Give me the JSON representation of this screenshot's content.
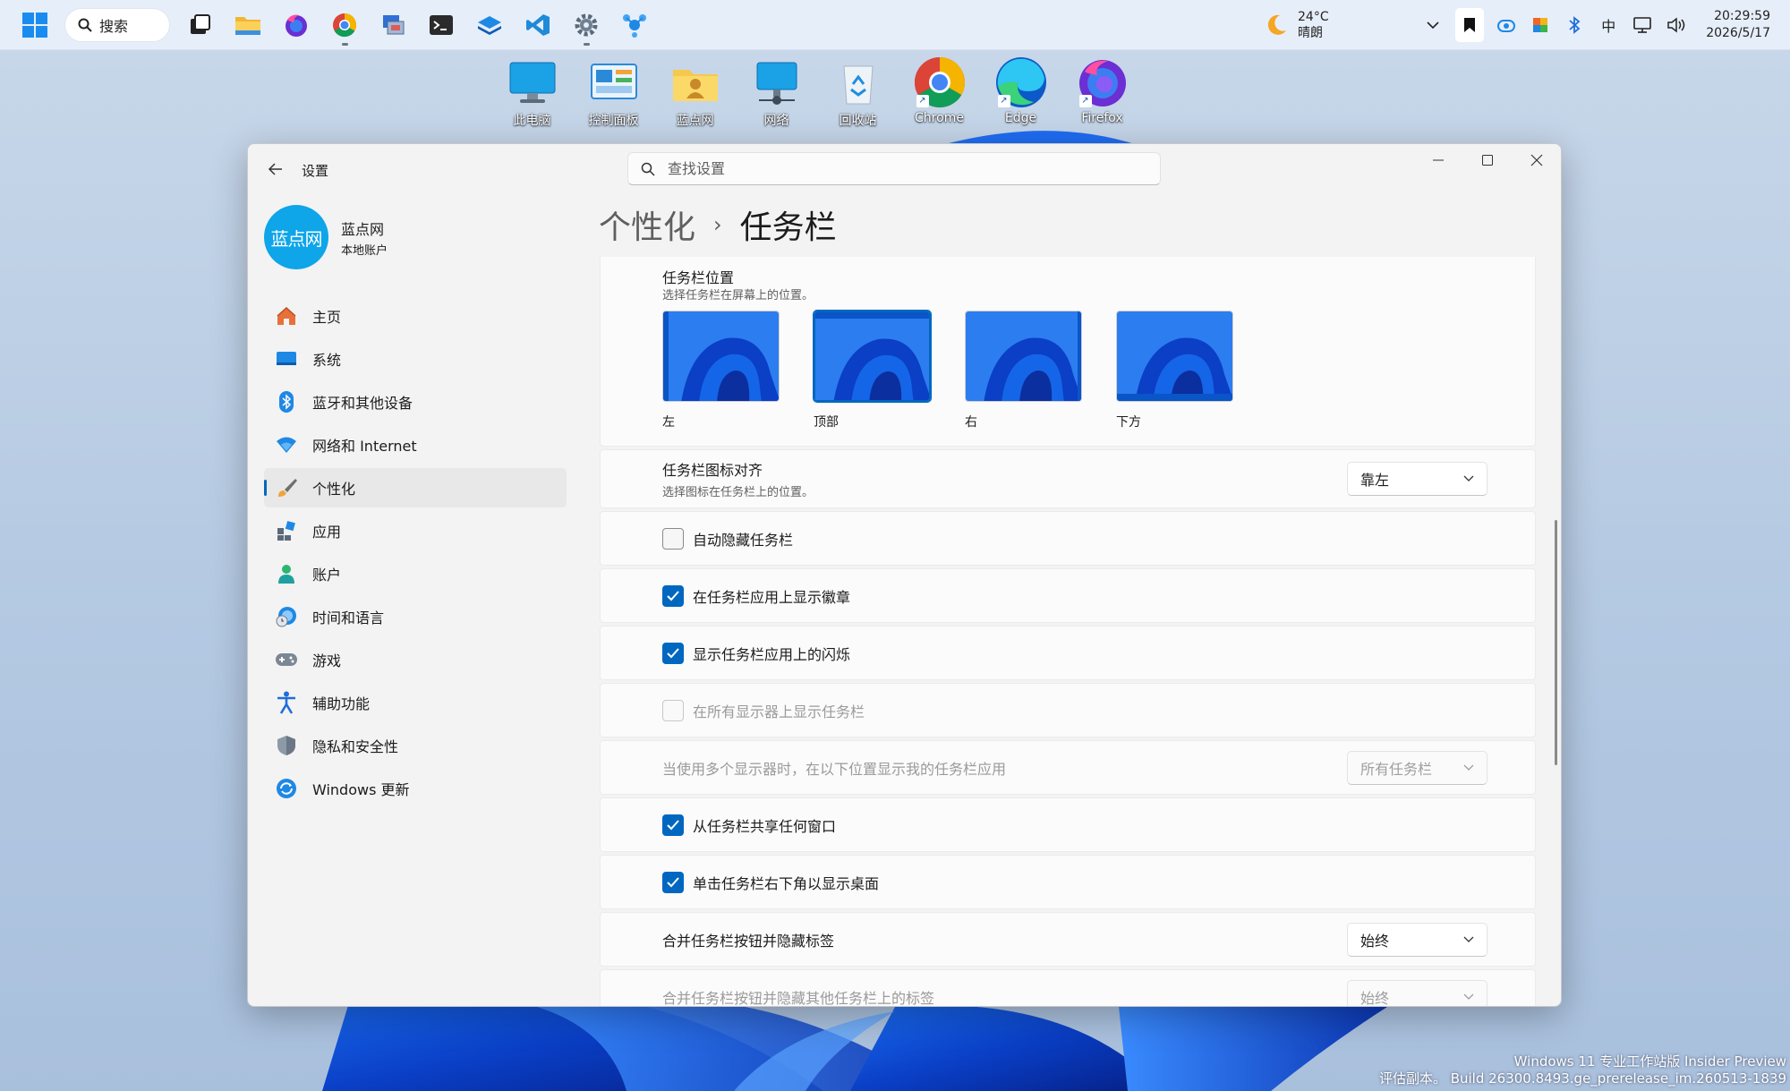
{
  "taskbar": {
    "search_label": "搜索",
    "weather_temp": "24°C",
    "weather_desc": "晴朗",
    "ime_label": "中",
    "time": "20:29:59",
    "date": "2026/5/17"
  },
  "desktop": {
    "icons": [
      {
        "label": "此电脑",
        "icon": "computer-icon"
      },
      {
        "label": "控制面板",
        "icon": "control-panel-icon"
      },
      {
        "label": "蓝点网",
        "icon": "user-folder-icon"
      },
      {
        "label": "网络",
        "icon": "network-icon"
      },
      {
        "label": "回收站",
        "icon": "recycle-bin-icon"
      },
      {
        "label": "Chrome",
        "icon": "chrome-icon"
      },
      {
        "label": "Edge",
        "icon": "edge-icon"
      },
      {
        "label": "Firefox",
        "icon": "firefox-icon"
      }
    ],
    "watermark_line1": "Windows 11 专业工作站版 Insider Preview",
    "watermark_line2": "评估副本。 Build 26300.8493.ge_prerelease_im.260513-1839"
  },
  "window": {
    "title": "设置",
    "search_placeholder": "查找设置",
    "profile": {
      "name": "蓝点网",
      "sub": "本地账户",
      "avatar_text": "蓝点网"
    },
    "nav": [
      {
        "label": "主页",
        "icon": "home-icon"
      },
      {
        "label": "系统",
        "icon": "system-icon"
      },
      {
        "label": "蓝牙和其他设备",
        "icon": "bluetooth-icon"
      },
      {
        "label": "网络和 Internet",
        "icon": "wifi-icon"
      },
      {
        "label": "个性化",
        "icon": "brush-icon",
        "selected": true
      },
      {
        "label": "应用",
        "icon": "apps-icon"
      },
      {
        "label": "账户",
        "icon": "account-icon"
      },
      {
        "label": "时间和语言",
        "icon": "globe-clock-icon"
      },
      {
        "label": "游戏",
        "icon": "gamepad-icon"
      },
      {
        "label": "辅助功能",
        "icon": "accessibility-icon"
      },
      {
        "label": "隐私和安全性",
        "icon": "shield-icon"
      },
      {
        "label": "Windows 更新",
        "icon": "update-icon"
      }
    ],
    "breadcrumb": {
      "parent": "个性化",
      "current": "任务栏"
    }
  },
  "settings": {
    "position": {
      "title": "任务栏位置",
      "sub": "选择任务栏在屏幕上的位置。",
      "options": [
        {
          "label": "左",
          "selected": false
        },
        {
          "label": "顶部",
          "selected": true
        },
        {
          "label": "右",
          "selected": false
        },
        {
          "label": "下方",
          "selected": false
        }
      ]
    },
    "alignment": {
      "title": "任务栏图标对齐",
      "sub": "选择图标在任务栏上的位置。",
      "value": "靠左"
    },
    "checkboxes": [
      {
        "label": "自动隐藏任务栏",
        "checked": false,
        "disabled": false
      },
      {
        "label": "在任务栏应用上显示徽章",
        "checked": true,
        "disabled": false
      },
      {
        "label": "显示任务栏应用上的闪烁",
        "checked": true,
        "disabled": false
      },
      {
        "label": "在所有显示器上显示任务栏",
        "checked": false,
        "disabled": true
      }
    ],
    "multi_display": {
      "label": "当使用多个显示器时，在以下位置显示我的任务栏应用",
      "value": "所有任务栏"
    },
    "checkboxes2": [
      {
        "label": "从任务栏共享任何窗口",
        "checked": true
      },
      {
        "label": "单击任务栏右下角以显示桌面",
        "checked": true
      }
    ],
    "combine": {
      "label": "合并任务栏按钮并隐藏标签",
      "value": "始终"
    },
    "combine_other": {
      "label": "合并任务栏按钮并隐藏其他任务栏上的标签",
      "value": "始终"
    }
  },
  "colors": {
    "accent": "#0067c0",
    "window_bg": "#f3f3f3",
    "card_bg": "#fbfbfb"
  }
}
